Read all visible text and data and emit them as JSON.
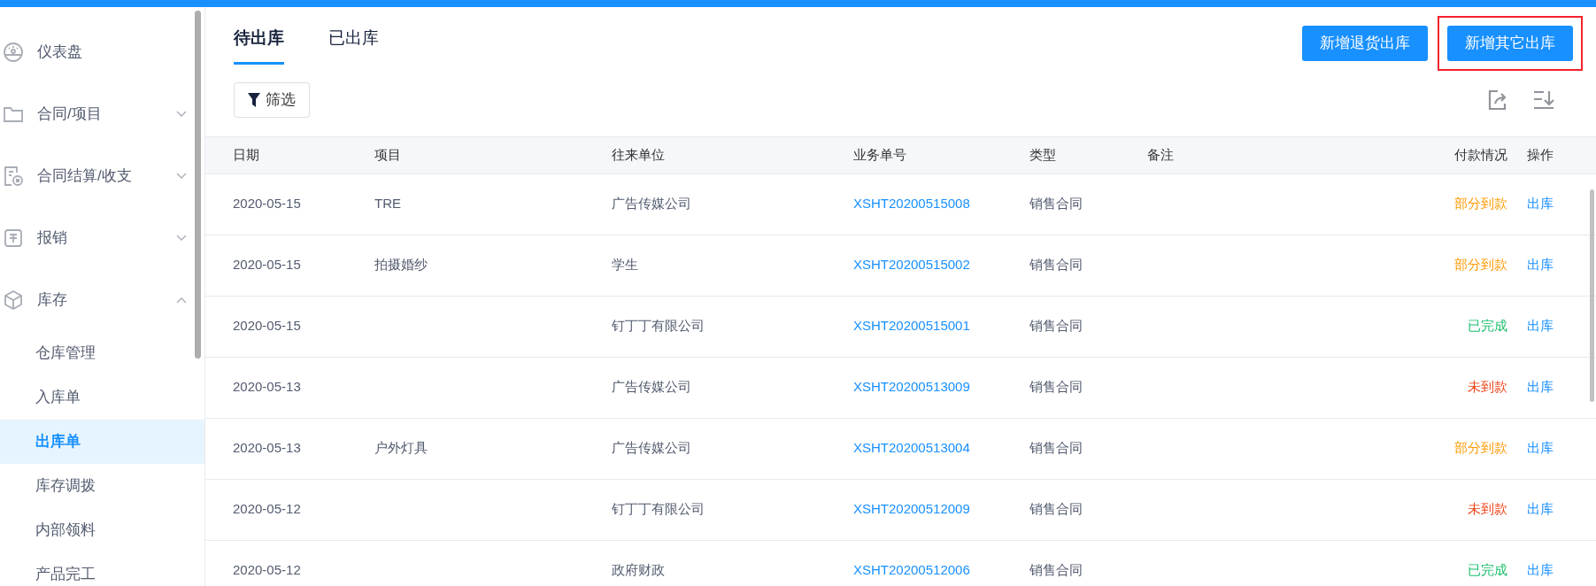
{
  "sidebar": {
    "items": [
      {
        "label": "仪表盘"
      },
      {
        "label": "合同/项目",
        "expanded": false
      },
      {
        "label": "合同结算/收支",
        "expanded": false
      },
      {
        "label": "报销",
        "expanded": false
      },
      {
        "label": "库存",
        "expanded": true,
        "children": [
          {
            "label": "仓库管理",
            "selected": false
          },
          {
            "label": "入库单",
            "selected": false
          },
          {
            "label": "出库单",
            "selected": true
          },
          {
            "label": "库存调拨",
            "selected": false
          },
          {
            "label": "内部领料",
            "selected": false
          },
          {
            "label": "产品完工",
            "selected": false
          }
        ]
      }
    ]
  },
  "tabs": [
    {
      "label": "待出库",
      "selected": true
    },
    {
      "label": "已出库",
      "selected": false
    }
  ],
  "buttons": [
    {
      "label": "新增退货出库",
      "highlighted": false
    },
    {
      "label": "新增其它出库",
      "highlighted": true
    }
  ],
  "filter_button": {
    "label": "筛选"
  },
  "table": {
    "columns": [
      "日期",
      "项目",
      "往来单位",
      "业务单号",
      "类型",
      "备注",
      "付款情况",
      "操作"
    ],
    "rows": [
      {
        "date": "2020-05-15",
        "project": "TRE",
        "partner": "广告传媒公司",
        "number": "XSHT20200515008",
        "type": "销售合同",
        "payment": {
          "text": "部分到款",
          "color": "#ff9900"
        },
        "action": "出库"
      },
      {
        "date": "2020-05-15",
        "project": "拍摄婚纱",
        "partner": "学生",
        "number": "XSHT20200515002",
        "type": "销售合同",
        "payment": {
          "text": "部分到款",
          "color": "#ff9900"
        },
        "action": "出库"
      },
      {
        "date": "2020-05-15",
        "partner": "钉丁丁有限公司",
        "number": "XSHT20200515001",
        "type": "销售合同",
        "payment": {
          "text": "已完成",
          "color": "#19be6b"
        },
        "action": "出库"
      },
      {
        "date": "2020-05-13",
        "partner": "广告传媒公司",
        "number": "XSHT20200513009",
        "type": "销售合同",
        "payment": {
          "text": "未到款",
          "color": "#ed4014"
        },
        "action": "出库"
      },
      {
        "date": "2020-05-13",
        "project": "户外灯具",
        "partner": "广告传媒公司",
        "number": "XSHT20200513004",
        "type": "销售合同",
        "payment": {
          "text": "部分到款",
          "color": "#ff9900"
        },
        "action": "出库"
      },
      {
        "date": "2020-05-12",
        "partner": "钉丁丁有限公司",
        "number": "XSHT20200512009",
        "type": "销售合同",
        "payment": {
          "text": "未到款",
          "color": "#ed4014"
        },
        "action": "出库"
      },
      {
        "date": "2020-05-12",
        "partner": "政府财政",
        "number": "XSHT20200512006",
        "type": "销售合同",
        "payment": {
          "text": "已完成",
          "color": "#19be6b"
        },
        "action": "出库"
      }
    ]
  }
}
